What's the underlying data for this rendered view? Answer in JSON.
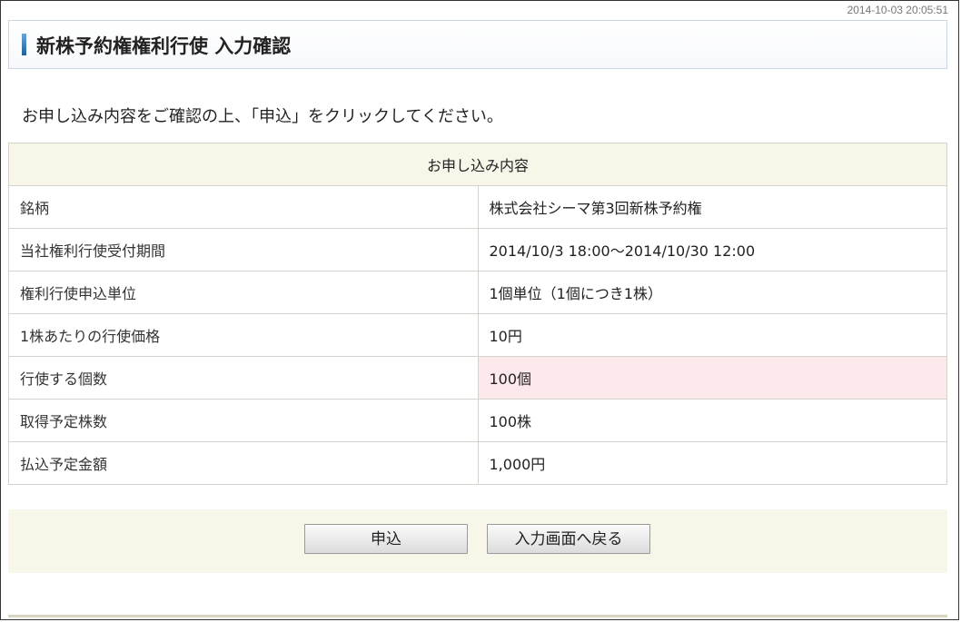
{
  "timestamp": "2014-10-03 20:05:51",
  "page_title": "新株予約権権利行使 入力確認",
  "instruction": "お申し込み内容をご確認の上、「申込」をクリックしてください。",
  "table": {
    "header": "お申し込み内容",
    "rows": [
      {
        "label": "銘柄",
        "value": "株式会社シーマ第3回新株予約権"
      },
      {
        "label": "当社権利行使受付期間",
        "value": "2014/10/3 18:00〜2014/10/30 12:00"
      },
      {
        "label": "権利行使申込単位",
        "value": "1個単位（1個につき1株）"
      },
      {
        "label": "1株あたりの行使価格",
        "value": "10円"
      },
      {
        "label": "行使する個数",
        "value": "100個"
      },
      {
        "label": "取得予定株数",
        "value": "100株"
      },
      {
        "label": "払込予定金額",
        "value": "1,000円"
      }
    ]
  },
  "buttons": {
    "apply_label": "申込",
    "back_label": "入力画面へ戻る"
  },
  "colors": {
    "highlight_row": "#fde8ec",
    "header_bg": "#f7f6e8",
    "title_accent": "#1e5f9e"
  }
}
